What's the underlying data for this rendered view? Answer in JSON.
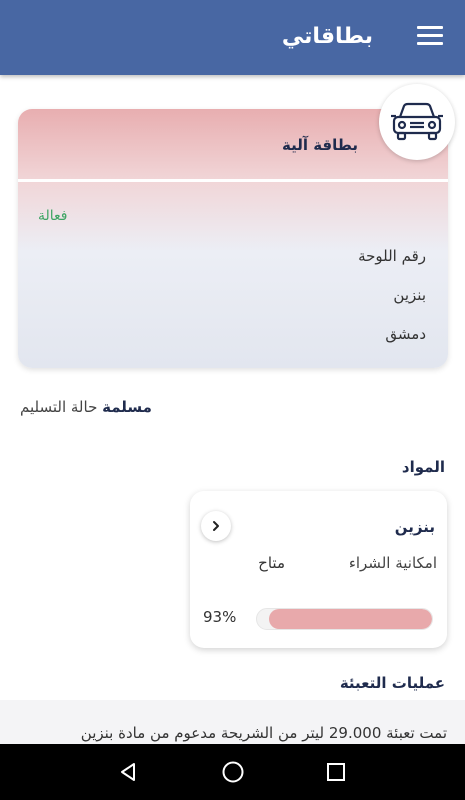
{
  "appbar": {
    "title": "بطاقاتي",
    "menu_icon": "hamburger-menu-icon"
  },
  "card": {
    "title": "بطاقة آلية",
    "status": "فعالة",
    "plate_label": "رقم اللوحة",
    "fuel_type": "بنزين",
    "city": "دمشق",
    "badge_icon": "car-icon",
    "status_color": "#3fa564"
  },
  "delivery": {
    "label": "حالة التسليم",
    "value": "مسلمة"
  },
  "materials": {
    "title": "المواد",
    "items": [
      {
        "name": "بنزين",
        "purchase_label": "امكانية الشراء",
        "purchase_value": "متاح",
        "percent_text": "93%",
        "percent": 93
      }
    ]
  },
  "operations": {
    "title": "عمليات التعبئة",
    "items": [
      {
        "text": "تمت تعبئة 29.000 ليتر  من الشريحة مدعوم من مادة بنزين"
      }
    ]
  },
  "navbar": {
    "back_icon": "back-triangle-icon",
    "home_icon": "home-circle-icon",
    "recent_icon": "recent-apps-square-icon"
  },
  "colors": {
    "appbar": "#4867a3",
    "accent_dark": "#1f2b4d",
    "progress": "#e8a9ab"
  }
}
